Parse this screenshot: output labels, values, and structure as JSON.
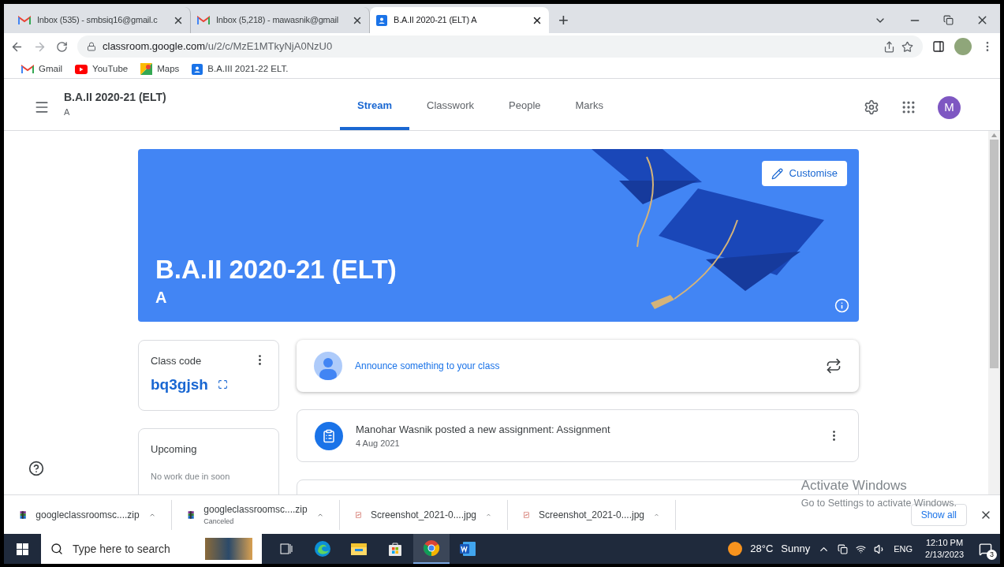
{
  "browser": {
    "tabs": [
      {
        "title": "Inbox (535) - smbsiq16@gmail.c",
        "kind": "gmail",
        "selected": false
      },
      {
        "title": "Inbox (5,218) - mawasnik@gmail",
        "kind": "gmail",
        "selected": false
      },
      {
        "title": "B.A.II 2020-21 (ELT) A",
        "kind": "classroom",
        "selected": true
      }
    ],
    "new_tab": "+",
    "address_host": "classroom.google.com",
    "address_path": "/u/2/c/MzE1MTkyNjA0NzU0",
    "bookmarks": [
      {
        "label": "Gmail",
        "kind": "gmail"
      },
      {
        "label": "YouTube",
        "kind": "youtube"
      },
      {
        "label": "Maps",
        "kind": "maps"
      },
      {
        "label": "B.A.III 2021-22 ELT.",
        "kind": "classroom"
      }
    ]
  },
  "classroom": {
    "title": "B.A.II 2020-21 (ELT)",
    "subtitle": "A",
    "tabs": [
      {
        "label": "Stream",
        "selected": true
      },
      {
        "label": "Classwork",
        "selected": false
      },
      {
        "label": "People",
        "selected": false
      },
      {
        "label": "Marks",
        "selected": false
      }
    ],
    "avatar": "M",
    "banner": {
      "title": "B.A.II 2020-21 (ELT)",
      "section": "A",
      "customise": "Customise"
    },
    "class_code": {
      "label": "Class code",
      "code": "bq3gjsh"
    },
    "upcoming": {
      "title": "Upcoming",
      "text": "No work due in soon"
    },
    "announce": "Announce something to your class",
    "posts": [
      {
        "text": "Manohar Wasnik posted a new assignment: Assignment",
        "date": "4 Aug 2021"
      }
    ]
  },
  "downloads": {
    "items": [
      {
        "name": "googleclassroomsc....zip",
        "kind": "zip"
      },
      {
        "name": "googleclassroomsc....zip",
        "kind": "zip",
        "status": "Canceled"
      },
      {
        "name": "Screenshot_2021-0....jpg",
        "kind": "jpg"
      },
      {
        "name": "Screenshot_2021-0....jpg",
        "kind": "jpg"
      }
    ],
    "show_all": "Show all"
  },
  "activation": {
    "title": "Activate Windows",
    "text": "Go to Settings to activate Windows."
  },
  "taskbar": {
    "search_placeholder": "Type here to search",
    "apps": [
      {
        "kind": "taskview",
        "active": false
      },
      {
        "kind": "edge",
        "active": false
      },
      {
        "kind": "explorer",
        "active": false
      },
      {
        "kind": "store",
        "active": false
      },
      {
        "kind": "chrome",
        "active": true
      },
      {
        "kind": "word",
        "active": false
      }
    ],
    "temperature": "28°C",
    "weather": "Sunny",
    "language": "ENG",
    "time": "12:10 PM",
    "date": "2/13/2023",
    "notifications": "3"
  }
}
